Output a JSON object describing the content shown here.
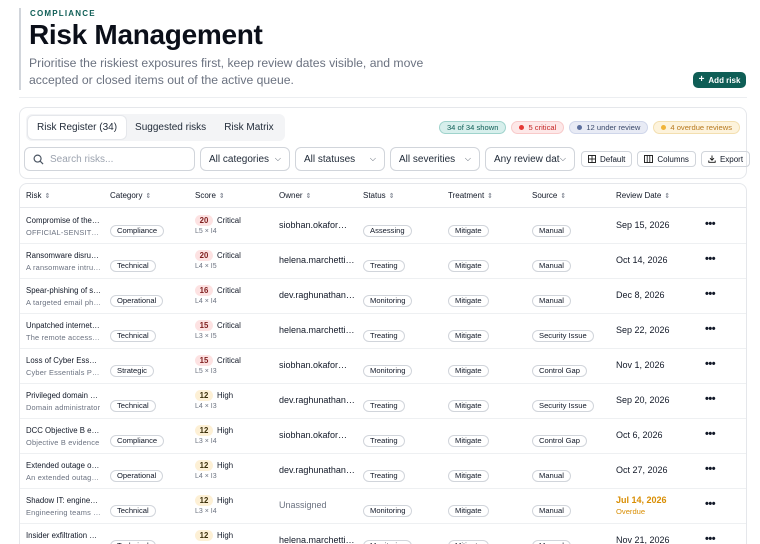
{
  "header": {
    "eyebrow": "COMPLIANCE",
    "title": "Risk Management",
    "subtitle": "Prioritise the riskiest exposures first, keep review dates visible, and move accepted or closed items out of the active queue.",
    "add_button": "Add risk"
  },
  "tabs": [
    {
      "label": "Risk Register (34)",
      "active": true
    },
    {
      "label": "Suggested risks",
      "active": false
    },
    {
      "label": "Risk Matrix",
      "active": false
    }
  ],
  "badges": {
    "shown": "34 of 34 shown",
    "critical": "5 critical",
    "under_review": "12 under review",
    "overdue": "4 overdue reviews"
  },
  "filters": {
    "search_placeholder": "Search risks...",
    "categories": "All categories",
    "statuses": "All statuses",
    "severities": "All severities",
    "review_date": "Any review date"
  },
  "tools": {
    "default": "Default",
    "columns": "Columns",
    "export": "Export"
  },
  "columns": [
    "Risk",
    "Category",
    "Score",
    "Owner",
    "Status",
    "Treatment",
    "Source",
    "Review Date"
  ],
  "rows": [
    {
      "name": "Compromise of the OFFICIAL-SENSITIVE",
      "desc": "OFFICIAL-SENSITIVE information",
      "category": "Compliance",
      "score": "20",
      "level": "Critical",
      "lxi": "L5 × I4",
      "owner": "siobhan.okafor@example",
      "status": "Assessing",
      "treatment": "Mitigate",
      "source": "Manual",
      "review": "Sep 15, 2026",
      "overdue": false
    },
    {
      "name": "Ransomware disruption",
      "desc": "A ransomware intrusion",
      "category": "Technical",
      "score": "20",
      "level": "Critical",
      "lxi": "L4 × I5",
      "owner": "helena.marchetti@example",
      "status": "Treating",
      "treatment": "Mitigate",
      "source": "Manual",
      "review": "Oct 14, 2026",
      "overdue": false
    },
    {
      "name": "Spear-phishing of staff",
      "desc": "A targeted email phishing",
      "category": "Operational",
      "score": "16",
      "level": "Critical",
      "lxi": "L4 × I4",
      "owner": "dev.raghunathan@example",
      "status": "Monitoring",
      "treatment": "Mitigate",
      "source": "Manual",
      "review": "Dec 8, 2026",
      "overdue": false
    },
    {
      "name": "Unpatched internet-facing",
      "desc": "The remote access gateway",
      "category": "Technical",
      "score": "15",
      "level": "Critical",
      "lxi": "L3 × I5",
      "owner": "helena.marchetti@example",
      "status": "Treating",
      "treatment": "Mitigate",
      "source": "Security Issue",
      "review": "Sep 22, 2026",
      "overdue": false
    },
    {
      "name": "Loss of Cyber Essentials",
      "desc": "Cyber Essentials Plus",
      "category": "Strategic",
      "score": "15",
      "level": "Critical",
      "lxi": "L5 × I3",
      "owner": "siobhan.okafor@example",
      "status": "Monitoring",
      "treatment": "Mitigate",
      "source": "Control Gap",
      "review": "Nov 1, 2026",
      "overdue": false
    },
    {
      "name": "Privileged domain account",
      "desc": "Domain administrator",
      "category": "Technical",
      "score": "12",
      "level": "High",
      "lxi": "L4 × I3",
      "owner": "dev.raghunathan@example",
      "status": "Treating",
      "treatment": "Mitigate",
      "source": "Security Issue",
      "review": "Sep 20, 2026",
      "overdue": false
    },
    {
      "name": "DCC Objective B evidence",
      "desc": "Objective B evidence",
      "category": "Compliance",
      "score": "12",
      "level": "High",
      "lxi": "L3 × I4",
      "owner": "siobhan.okafor@example",
      "status": "Treating",
      "treatment": "Mitigate",
      "source": "Control Gap",
      "review": "Oct 6, 2026",
      "overdue": false
    },
    {
      "name": "Extended outage of core",
      "desc": "An extended outage of",
      "category": "Operational",
      "score": "12",
      "level": "High",
      "lxi": "L4 × I3",
      "owner": "dev.raghunathan@example",
      "status": "Treating",
      "treatment": "Mitigate",
      "source": "Manual",
      "review": "Oct 27, 2026",
      "overdue": false
    },
    {
      "name": "Shadow IT: engineering",
      "desc": "Engineering teams using",
      "category": "Technical",
      "score": "12",
      "level": "High",
      "lxi": "L3 × I4",
      "owner": "Unassigned",
      "status": "Monitoring",
      "treatment": "Mitigate",
      "source": "Manual",
      "review": "Jul 14, 2026",
      "overdue": true,
      "overdue_label": "Overdue"
    },
    {
      "name": "Insider exfiltration of data",
      "desc": "",
      "category": "Technical",
      "score": "12",
      "level": "High",
      "lxi": "",
      "owner": "helena.marchetti@example",
      "status": "Monitoring",
      "treatment": "Mitigate",
      "source": "Manual",
      "review": "Nov 21, 2026",
      "overdue": false
    }
  ]
}
